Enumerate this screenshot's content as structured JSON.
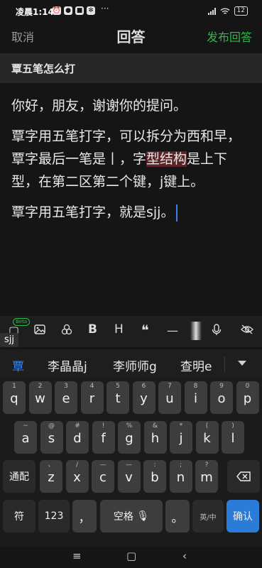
{
  "status": {
    "time": "凌晨1:14",
    "dots": "···",
    "battery": "12"
  },
  "header": {
    "cancel": "取消",
    "title": "回答",
    "publish": "发布回答"
  },
  "question": {
    "title": "覃五笔怎么打"
  },
  "answer": {
    "p1": "你好，朋友，谢谢你的提问。",
    "p2_a": "覃字用五笔打字，可以拆分为西和早，覃字最后一笔是丨，字",
    "p2_hl": "型结构",
    "p2_b": "是上下型，在第二区第二个键，j键上。",
    "p3": "覃字用五笔打字，就是sjj。"
  },
  "toolbar": {
    "beta": "Beta",
    "bold": "B",
    "heading": "H",
    "quote": "❝",
    "divider": "—"
  },
  "ime": {
    "composition": "sjj",
    "candidates": [
      "覃",
      "李晶晶j",
      "李师师g",
      "查明e"
    ],
    "row1": [
      {
        "n": "1",
        "l": "q"
      },
      {
        "n": "2",
        "l": "w"
      },
      {
        "n": "3",
        "l": "e"
      },
      {
        "n": "4",
        "l": "r"
      },
      {
        "n": "5",
        "l": "t"
      },
      {
        "n": "6",
        "l": "y"
      },
      {
        "n": "7",
        "l": "u"
      },
      {
        "n": "8",
        "l": "i"
      },
      {
        "n": "9",
        "l": "o"
      },
      {
        "n": "0",
        "l": "p"
      }
    ],
    "row2": [
      {
        "n": "~",
        "l": "a"
      },
      {
        "n": "@",
        "l": "s"
      },
      {
        "n": "#",
        "l": "d"
      },
      {
        "n": "!",
        "l": "f"
      },
      {
        "n": "%",
        "l": "g"
      },
      {
        "n": "&",
        "l": "h"
      },
      {
        "n": "*",
        "l": "j"
      },
      {
        "n": "(",
        "l": "k"
      },
      {
        "n": ")",
        "l": "l"
      }
    ],
    "row3": [
      {
        "n": "、",
        "l": "z"
      },
      {
        "n": "/",
        "l": "x"
      },
      {
        "n": "—",
        "l": "c"
      },
      {
        "n": "—",
        "l": "v"
      },
      {
        "n": ":",
        "l": "b"
      },
      {
        "n": ";",
        "l": "n"
      },
      {
        "n": "?",
        "l": "m"
      }
    ],
    "shift_label": "通配",
    "symbol": "符",
    "num": "123",
    "comma": "，",
    "space": "空格",
    "period": "。",
    "lang": "英/中",
    "enter": "确认"
  },
  "colors": {
    "accent_green": "#31b64d",
    "enter_blue": "#2b7cd9",
    "highlight": "#5a2426"
  }
}
